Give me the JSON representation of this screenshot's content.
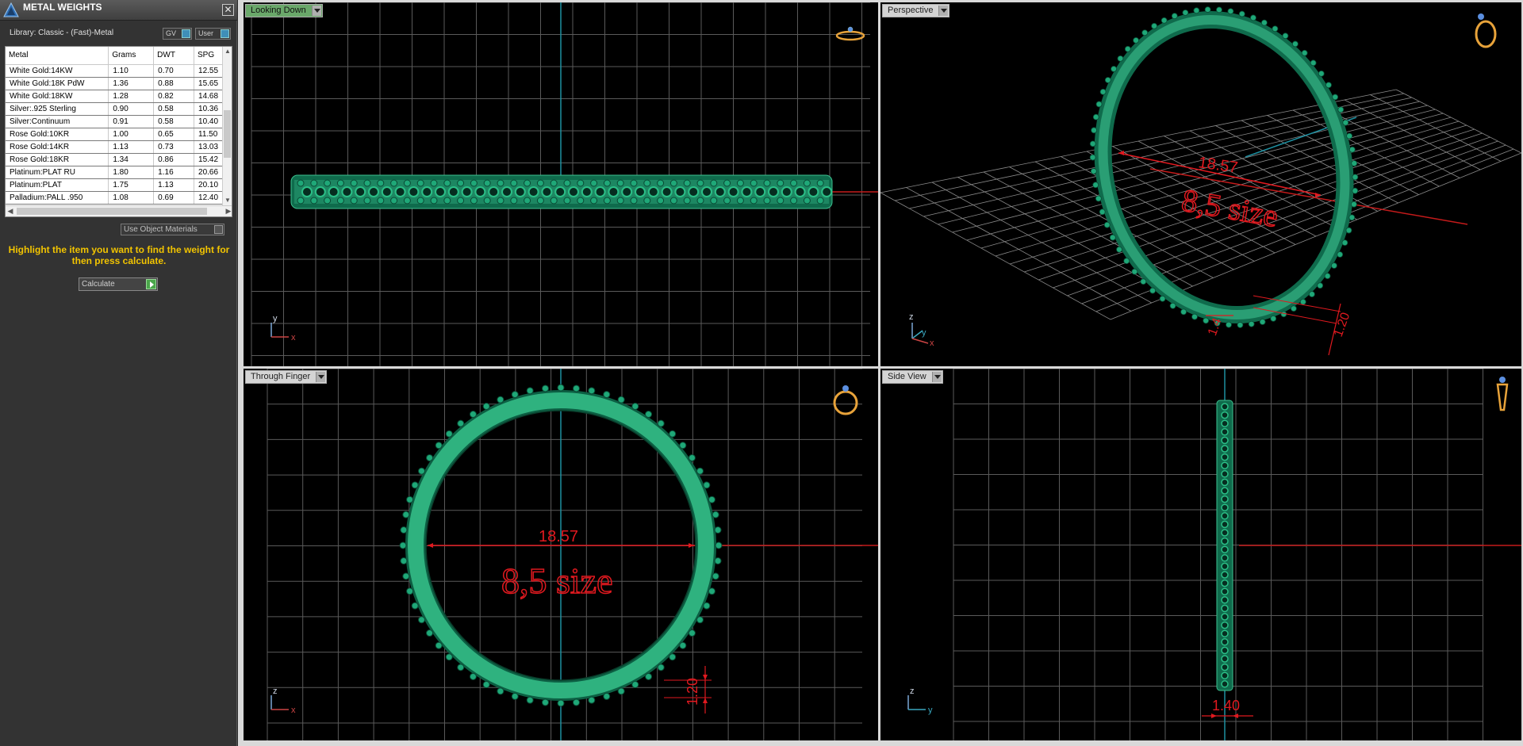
{
  "panel": {
    "title": "METAL WEIGHTS",
    "close_label": "✕",
    "library_label": "Library: Classic - (Fast)-Metal",
    "gv_label": "GV",
    "user_label": "User",
    "use_object_materials": "Use Object Materials",
    "hint": "Highlight the item you want to find the weight for then press calculate.",
    "calculate_label": "Calculate"
  },
  "table": {
    "columns": [
      "Metal",
      "Grams",
      "DWT",
      "SPG"
    ],
    "rows": [
      [
        "White Gold:14KW",
        "1.10",
        "0.70",
        "12.55"
      ],
      [
        "White Gold:18K PdW",
        "1.36",
        "0.88",
        "15.65"
      ],
      [
        "White Gold:18KW",
        "1.28",
        "0.82",
        "14.68"
      ],
      [
        "Silver:.925 Sterling",
        "0.90",
        "0.58",
        "10.36"
      ],
      [
        "Silver:Continuum",
        "0.91",
        "0.58",
        "10.40"
      ],
      [
        "Rose Gold:10KR",
        "1.00",
        "0.65",
        "11.50"
      ],
      [
        "Rose Gold:14KR",
        "1.13",
        "0.73",
        "13.03"
      ],
      [
        "Rose Gold:18KR",
        "1.34",
        "0.86",
        "15.42"
      ],
      [
        "Platinum:PLAT RU",
        "1.80",
        "1.16",
        "20.66"
      ],
      [
        "Platinum:PLAT",
        "1.75",
        "1.13",
        "20.10"
      ],
      [
        "Palladium:PALL .950",
        "1.08",
        "0.69",
        "12.40"
      ]
    ]
  },
  "viewports": {
    "top_left": "Looking Down",
    "top_right": "Perspective",
    "bottom_left": "Through Finger",
    "bottom_right": "Side View"
  },
  "dimensions": {
    "diameter": "18.57",
    "size_text": "8,5 size",
    "height": "1.20",
    "width": "1.40",
    "persp_width": "1.4",
    "persp_height": "1.20"
  },
  "axes": {
    "x": "x",
    "y": "y",
    "z": "z"
  },
  "colors": {
    "ring": "#2a9e74",
    "ring_dark": "#0f6b4c",
    "dim": "#e0191f",
    "axis_x": "#c41a1a",
    "axis_y": "#1e8fa0",
    "grid": "#5a5a5a",
    "hint": "#f2c400",
    "gold_icon": "#e8a33a"
  }
}
